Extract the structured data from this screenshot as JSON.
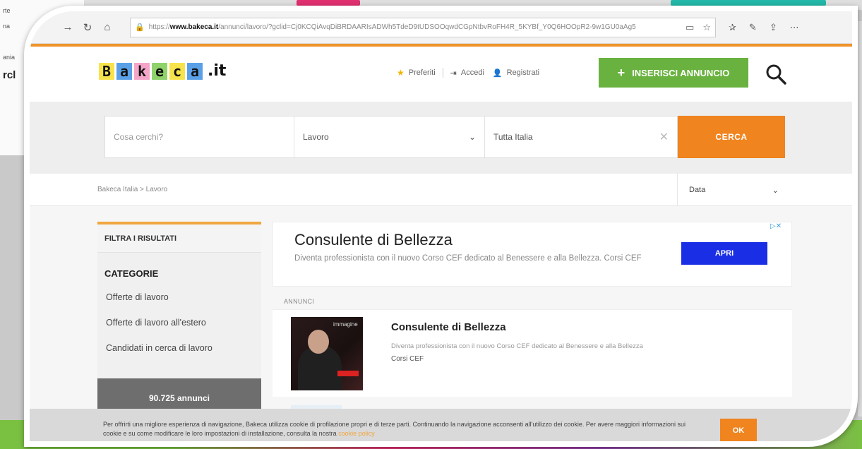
{
  "background": {
    "left_items": [
      "rte",
      "na",
      "",
      "ania",
      "rcl"
    ]
  },
  "browser": {
    "url_domain": "www.bakeca.it",
    "url_prefix": "https://",
    "url_rest": "/annunci/lavoro/?gclid=Cj0KCQiAvqDiBRDAARIsADWh5TdeD9tUDSOOqwdCGpNtbvRoFH4R_5KYBf_Y0Q6HOOpR2-9w1GU0aAg5"
  },
  "header": {
    "logo_letters": [
      "B",
      "a",
      "k",
      "e",
      "c",
      "a"
    ],
    "logo_colors": [
      "#f7e34b",
      "#5aa0e6",
      "#f5a6c8",
      "#8fd36a",
      "#f7e34b",
      "#5aa0e6"
    ],
    "logo_suffix": ".it",
    "links": {
      "favorites": "Preferiti",
      "login": "Accedi",
      "register": "Registrati"
    },
    "post_button": "INSERISCI ANNUNCIO"
  },
  "search": {
    "query_placeholder": "Cosa cerchi?",
    "category_value": "Lavoro",
    "location_value": "Tutta Italia",
    "submit_label": "CERCA"
  },
  "breadcrumb": {
    "text": "Bakeca Italia > Lavoro",
    "sort_value": "Data"
  },
  "sidebar": {
    "filter_title": "FILTRA I RISULTATI",
    "categories_title": "CATEGORIE",
    "items": [
      "Offerte di lavoro",
      "Offerte di lavoro all'estero",
      "Candidati in cerca di lavoro"
    ],
    "count": "90.725 annunci"
  },
  "ad": {
    "title": "Consulente di Bellezza",
    "description": "Diventa professionista con il nuovo Corso CEF dedicato al Benessere e alla Bellezza. Corsi CEF",
    "button": "APRI",
    "choices": "▷✕"
  },
  "listings_label": "ANNUNCI",
  "listing": {
    "title": "Consulente di Bellezza",
    "description": "Diventa professionista con il nuovo Corso CEF dedicato al Benessere e alla Bellezza",
    "source": "Corsi CEF",
    "thumb_badge": "immagine"
  },
  "cookie": {
    "text": "Per offrirti una migliore esperienza di navigazione, Bakeca utilizza cookie di profilazione propri e di terze parti. Continuando la navigazione acconsenti all'utilizzo dei cookie. Per avere maggiori informazioni sui cookie e su come modificare le loro impostazioni di installazione, consulta la nostra ",
    "link": "cookie policy",
    "ok": "OK"
  }
}
